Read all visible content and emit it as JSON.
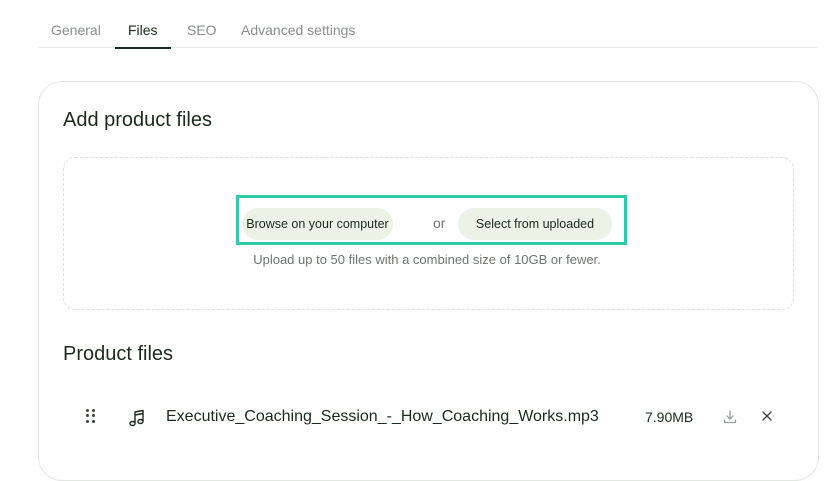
{
  "tabs": [
    {
      "label": "General",
      "active": false
    },
    {
      "label": "Files",
      "active": true
    },
    {
      "label": "SEO",
      "active": false
    },
    {
      "label": "Advanced settings",
      "active": false
    }
  ],
  "upload": {
    "title": "Add product files",
    "browse_label": "Browse on your computer",
    "or_label": "or",
    "select_label": "Select from uploaded",
    "hint": "Upload up to 50 files with a combined size of 10GB or fewer."
  },
  "product_files": {
    "title": "Product files",
    "files": [
      {
        "name": "Executive_Coaching_Session_-_How_Coaching_Works.mp3",
        "size": "7.90MB",
        "icon": "music-icon"
      }
    ]
  },
  "colors": {
    "highlight": "#2ecbaa",
    "pill_bg": "#edf2e6",
    "text": "#1b2a1f",
    "muted": "#8a8f8b"
  }
}
